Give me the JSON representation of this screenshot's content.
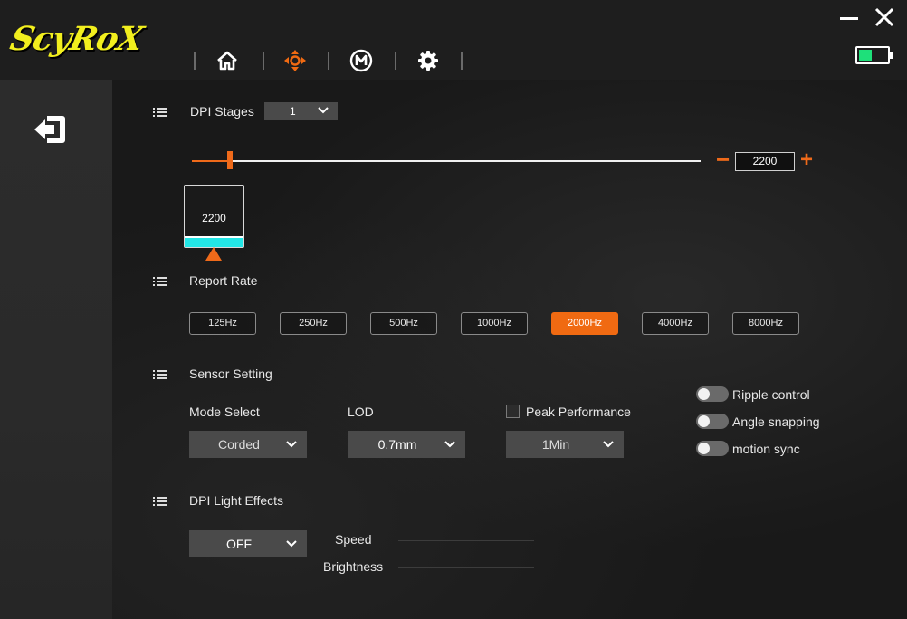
{
  "app": {
    "logo_text": "ScyRoX"
  },
  "nav": {
    "items": [
      {
        "name": "home",
        "icon": "home-icon",
        "active": false
      },
      {
        "name": "dpi",
        "icon": "crosshair-icon",
        "active": true
      },
      {
        "name": "macro",
        "icon": "macro-m-icon",
        "active": false
      },
      {
        "name": "settings",
        "icon": "gear-icon",
        "active": false
      }
    ],
    "active_color": "#f06a12"
  },
  "window": {
    "battery_color": "#1ee07a"
  },
  "dpi": {
    "title": "DPI Stages",
    "stages_selected": "1",
    "value": "2200",
    "slider_fraction": 0.075,
    "minus_label": "−",
    "plus_label": "+",
    "stage_card": {
      "value": "2200",
      "color": "#22e6e6"
    }
  },
  "report_rate": {
    "title": "Report Rate",
    "options": [
      "125Hz",
      "250Hz",
      "500Hz",
      "1000Hz",
      "2000Hz",
      "4000Hz",
      "8000Hz"
    ],
    "selected": "2000Hz"
  },
  "sensor": {
    "title": "Sensor Setting",
    "mode_label": "Mode Select",
    "mode_value": "Corded",
    "lod_label": "LOD",
    "lod_value": "0.7mm",
    "peak_label": "Peak Performance",
    "peak_checked": false,
    "peak_value": "1Min",
    "toggles": [
      {
        "label": "Ripple control",
        "on": false
      },
      {
        "label": "Angle snapping",
        "on": false
      },
      {
        "label": "motion sync",
        "on": false
      }
    ]
  },
  "light": {
    "title": "DPI Light Effects",
    "mode_value": "OFF",
    "speed_label": "Speed",
    "brightness_label": "Brightness"
  },
  "accent": "#ef6a1a"
}
